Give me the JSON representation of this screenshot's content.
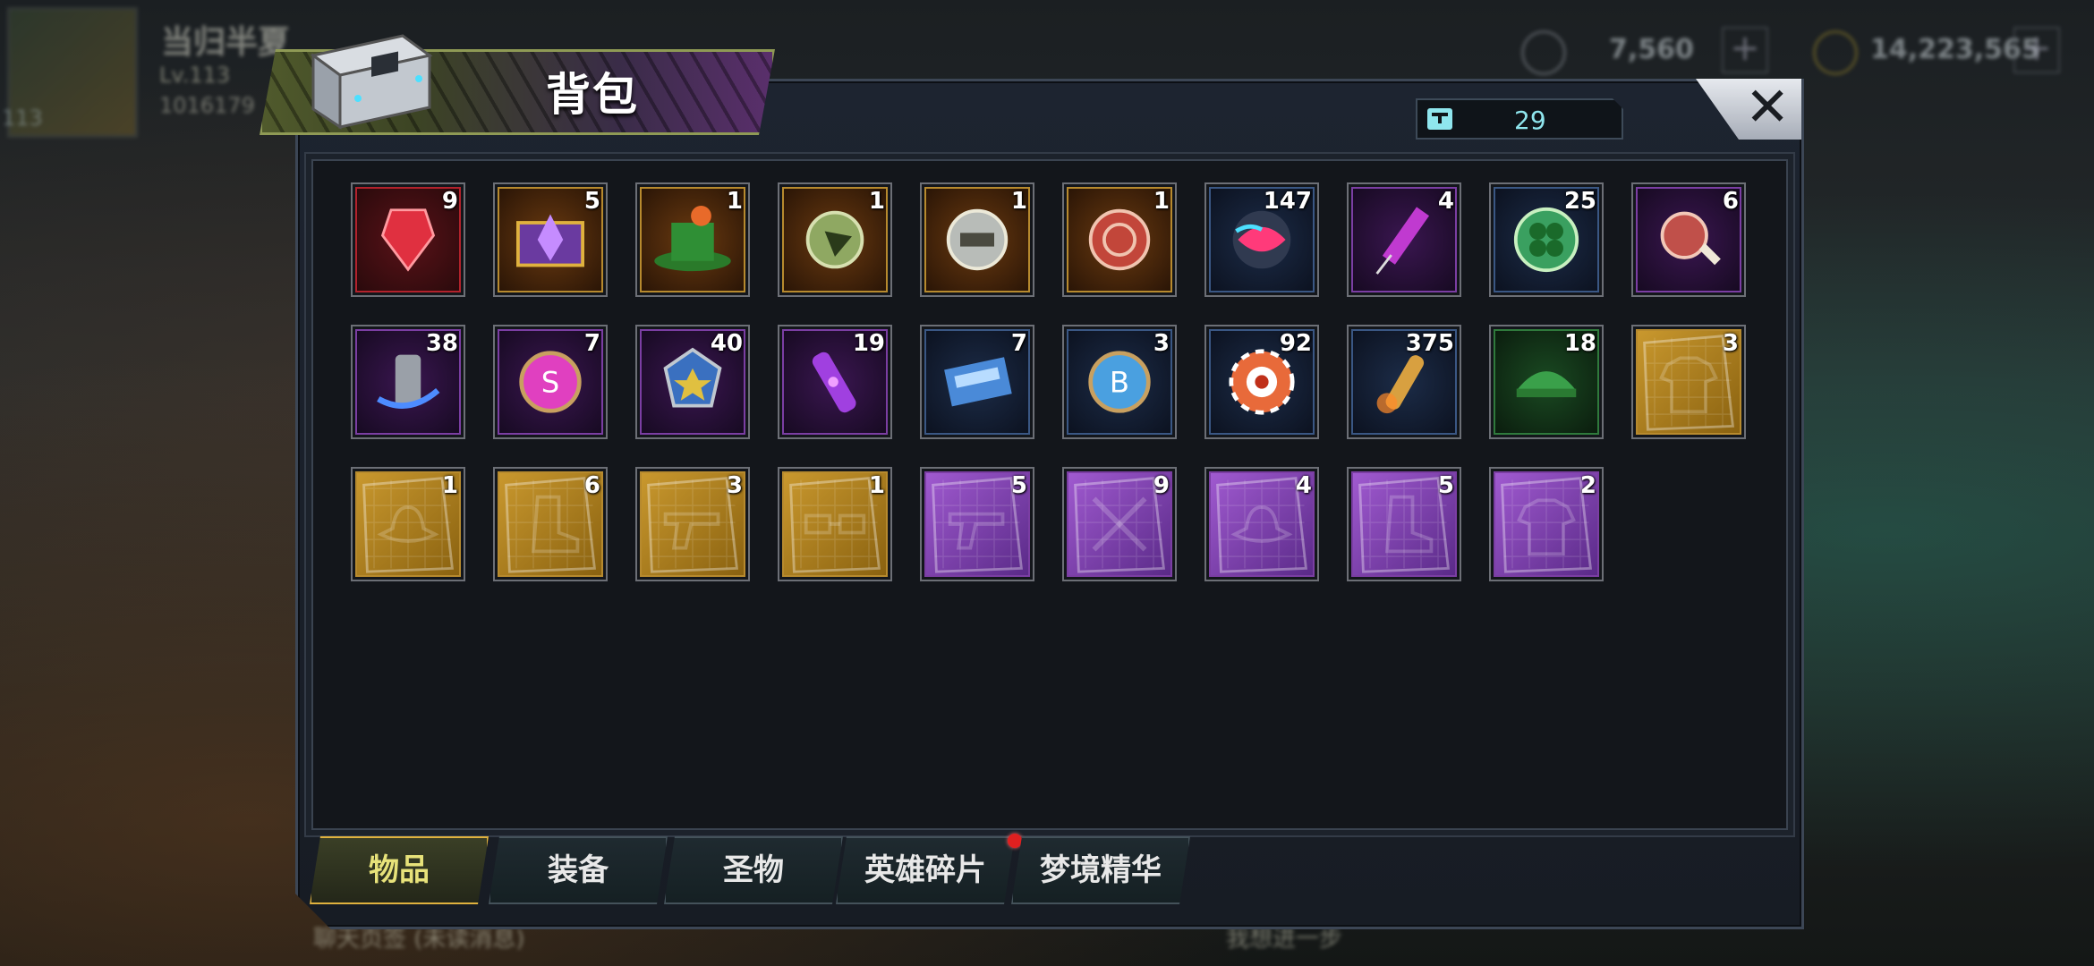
{
  "background_hud": {
    "player_name": "当归半夏",
    "level": "Lv.113",
    "player_id": "1016179",
    "avatar_level": "113",
    "currency1": "7,560",
    "currency2": "14,223,565",
    "plus": "+",
    "bottom_left": "聊天页签 (未读消息)",
    "bottom_right": "我想进一步"
  },
  "title": "背包",
  "capacity": "29",
  "close_label": "✕",
  "items": [
    {
      "count": "9",
      "rarity": "red",
      "icon": "red-gem-icon"
    },
    {
      "count": "5",
      "rarity": "gold",
      "icon": "treasure-chest-icon"
    },
    {
      "count": "1",
      "rarity": "gold",
      "icon": "party-hat-icon"
    },
    {
      "count": "1",
      "rarity": "gold",
      "icon": "green-token-icon"
    },
    {
      "count": "1",
      "rarity": "gold",
      "icon": "silver-coin-icon"
    },
    {
      "count": "1",
      "rarity": "gold",
      "icon": "target-coin-icon"
    },
    {
      "count": "147",
      "rarity": "blue",
      "icon": "lips-icon"
    },
    {
      "count": "4",
      "rarity": "purple",
      "icon": "syringe-icon"
    },
    {
      "count": "25",
      "rarity": "blue",
      "icon": "clover-coin-icon"
    },
    {
      "count": "6",
      "rarity": "purple",
      "icon": "meat-icon"
    },
    {
      "count": "38",
      "rarity": "purple",
      "icon": "spray-can-icon"
    },
    {
      "count": "7",
      "rarity": "purple",
      "icon": "bottle-cap-s-icon"
    },
    {
      "count": "40",
      "rarity": "purple",
      "icon": "police-badge-icon"
    },
    {
      "count": "19",
      "rarity": "purple",
      "icon": "vial-icon"
    },
    {
      "count": "7",
      "rarity": "blue",
      "icon": "cinema-ticket-icon"
    },
    {
      "count": "3",
      "rarity": "blue",
      "icon": "bottle-cap-b-icon"
    },
    {
      "count": "92",
      "rarity": "blue",
      "icon": "casino-chip-icon"
    },
    {
      "count": "375",
      "rarity": "blue",
      "icon": "bullet-icon"
    },
    {
      "count": "18",
      "rarity": "green",
      "icon": "green-cap-icon"
    },
    {
      "count": "3",
      "rarity": "gold",
      "icon": "shirt-blueprint-icon"
    },
    {
      "count": "1",
      "rarity": "gold",
      "icon": "hat-blueprint-icon"
    },
    {
      "count": "6",
      "rarity": "gold",
      "icon": "boot-blueprint-icon"
    },
    {
      "count": "3",
      "rarity": "gold",
      "icon": "pistol-blueprint-icon"
    },
    {
      "count": "1",
      "rarity": "gold",
      "icon": "glasses-blueprint-icon"
    },
    {
      "count": "5",
      "rarity": "purple",
      "icon": "pistol-blueprint-icon"
    },
    {
      "count": "9",
      "rarity": "purple",
      "icon": "swords-blueprint-icon"
    },
    {
      "count": "4",
      "rarity": "purple",
      "icon": "hat-blueprint-icon"
    },
    {
      "count": "5",
      "rarity": "purple",
      "icon": "boot-blueprint-icon"
    },
    {
      "count": "2",
      "rarity": "purple",
      "icon": "shirt-blueprint-icon"
    }
  ],
  "tabs": [
    {
      "label": "物品",
      "active": true
    },
    {
      "label": "装备",
      "active": false
    },
    {
      "label": "圣物",
      "active": false
    },
    {
      "label": "英雄碎片",
      "active": false,
      "notification": true
    },
    {
      "label": "梦境精华",
      "active": false
    }
  ],
  "colors": {
    "accent_gold": "#e0b23e",
    "capacity_text": "#8fe6ee",
    "notification": "#e02020"
  }
}
